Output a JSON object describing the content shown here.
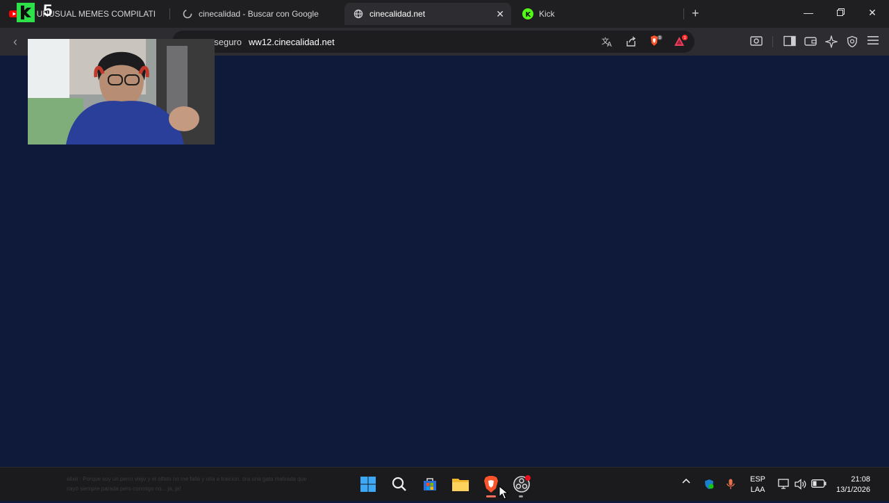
{
  "browser": {
    "tabs": [
      {
        "label": "50 UNUSUAL MEMES COMPILATI",
        "active": false
      },
      {
        "label": "cinecalidad - Buscar con Google",
        "active": false
      },
      {
        "label": "cinecalidad.net",
        "active": true
      },
      {
        "label": "Kick",
        "active": false
      }
    ],
    "new_tab_icon": "plus-icon",
    "window_controls": [
      "minimize-icon",
      "restore-icon",
      "close-icon"
    ]
  },
  "address_bar": {
    "security_text": "No seguro",
    "url": "ww12.cinecalidad.net",
    "shields_badge": "3",
    "rewards_badge": "1"
  },
  "overlay": {
    "logo_text": "5"
  },
  "taskbar": {
    "chat_text": "alixé : Porque soy un perro viejo y el olfato no me falla y olía a traicion. ora una gata malvada que cayó siempre parada pero conmigo no... ja, ja!",
    "language_line1": "ESP",
    "language_line2": "LAA",
    "time": "21:08",
    "date": "13/1/2026"
  },
  "colors": {
    "page_background": "#0f1a3a",
    "tab_strip": "#1f1f22",
    "toolbar": "#2d2d31",
    "brave_accent": "#fb542b"
  }
}
